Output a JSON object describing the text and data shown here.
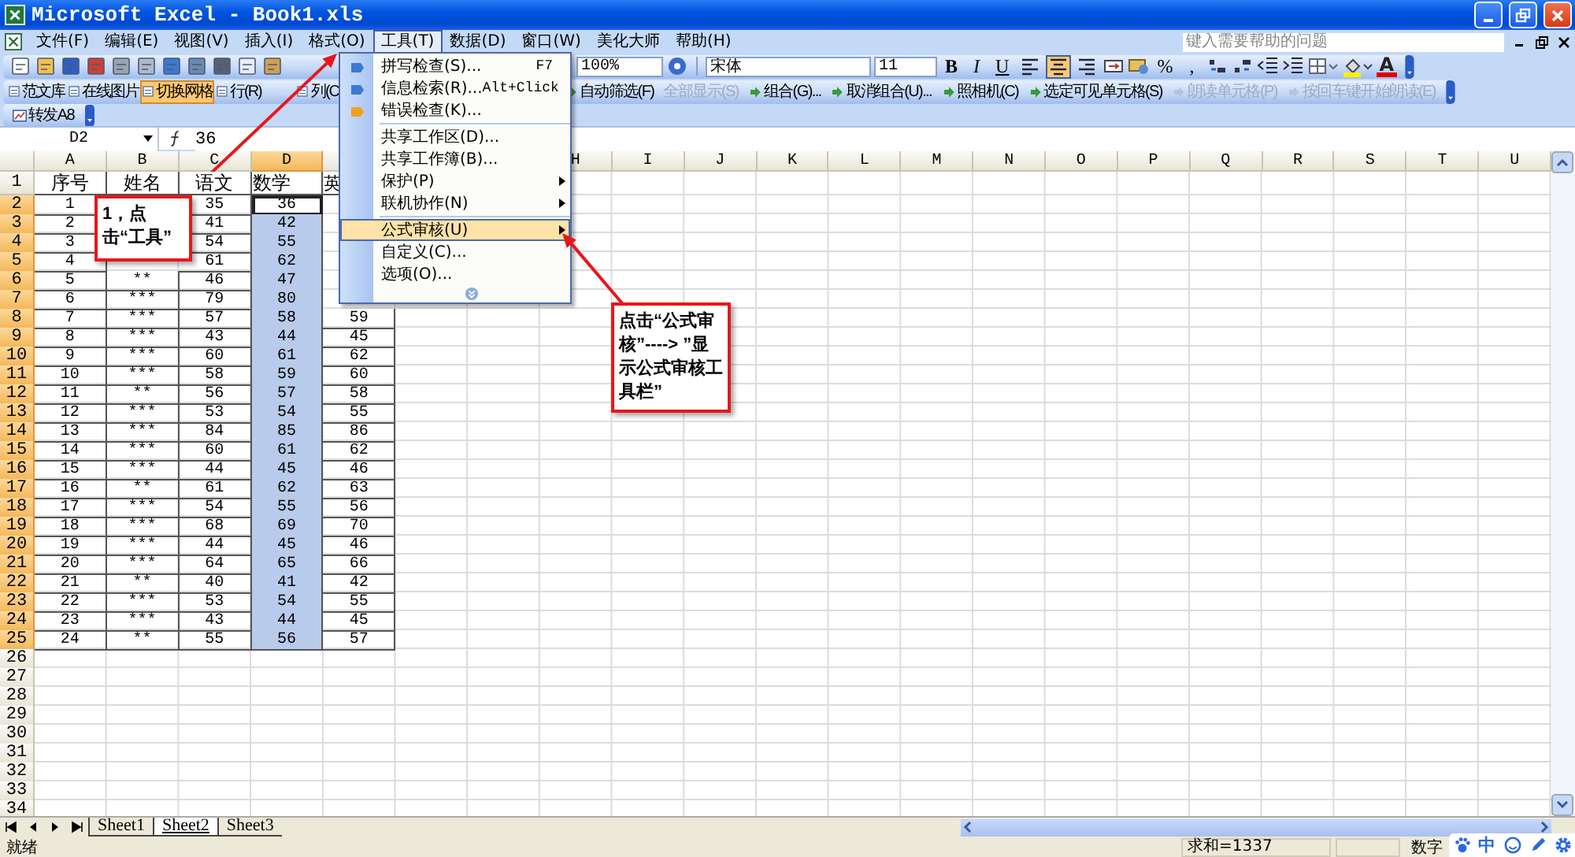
{
  "window": {
    "title": "Microsoft Excel - Book1.xls"
  },
  "menu_bar": {
    "items": [
      {
        "label": "文件(F)",
        "selected": false
      },
      {
        "label": "编辑(E)",
        "selected": false
      },
      {
        "label": "视图(V)",
        "selected": false
      },
      {
        "label": "插入(I)",
        "selected": false
      },
      {
        "label": "格式(O)",
        "selected": false
      },
      {
        "label": "工具(T)",
        "selected": true
      },
      {
        "label": "数据(D)",
        "selected": false
      },
      {
        "label": "窗口(W)",
        "selected": false
      },
      {
        "label": "美化大师",
        "selected": false
      },
      {
        "label": "帮助(H)",
        "selected": false
      }
    ],
    "help_placeholder": "键入需要帮助的问题"
  },
  "formatting_toolbar": {
    "zoom": "100%",
    "font": "宋体",
    "size": "11",
    "style_buttons": [
      "B",
      "I",
      "U"
    ],
    "align_buttons": [
      {
        "selected": false
      },
      {
        "selected": true
      },
      {
        "selected": false
      }
    ],
    "number_buttons": [
      "%",
      ","
    ],
    "font_color_label": "A"
  },
  "toolbar_2": {
    "left": [
      {
        "label": "范文库",
        "selected": false
      },
      {
        "label": "在线图片",
        "selected": false
      },
      {
        "label": "切换网格",
        "selected": true
      },
      {
        "label": "行(R)",
        "selected": false
      },
      {
        "label": "列(C",
        "selected": false
      }
    ],
    "right": [
      {
        "label": "自动筛选(F)",
        "disabled": false
      },
      {
        "label": "全部显示(S)",
        "disabled": true
      },
      {
        "label": "组合(G)...",
        "disabled": false
      },
      {
        "label": "取消组合(U)...",
        "disabled": false
      },
      {
        "label": "照相机(C)",
        "disabled": false
      },
      {
        "label": "选定可见单元格(S)",
        "disabled": false
      },
      {
        "label": "朗读单元格(P)",
        "disabled": true
      },
      {
        "label": "按回车键开始朗读(E)",
        "disabled": true
      }
    ]
  },
  "toolbar_3": {
    "button": "转发A8"
  },
  "formula_bar": {
    "name_box": "D2",
    "formula": "36"
  },
  "tools_menu": {
    "items": [
      {
        "kind": "item",
        "label": "拼写检查(S)...",
        "shortcut": "F7",
        "submenu": false,
        "selected": false
      },
      {
        "kind": "item",
        "label": "信息检索(R)...",
        "shortcut": "Alt+Click",
        "submenu": false,
        "selected": false
      },
      {
        "kind": "item",
        "label": "错误检查(K)...",
        "submenu": false,
        "selected": false
      },
      {
        "kind": "separator"
      },
      {
        "kind": "item",
        "label": "共享工作区(D)...",
        "submenu": false,
        "selected": false
      },
      {
        "kind": "item",
        "label": "共享工作簿(B)...",
        "submenu": false,
        "selected": false
      },
      {
        "kind": "item",
        "label": "保护(P)",
        "submenu": true,
        "selected": false
      },
      {
        "kind": "item",
        "label": "联机协作(N)",
        "submenu": true,
        "selected": false
      },
      {
        "kind": "separator"
      },
      {
        "kind": "item",
        "label": "公式审核(U)",
        "submenu": true,
        "selected": true
      },
      {
        "kind": "item",
        "label": "自定义(C)...",
        "submenu": false,
        "selected": false
      },
      {
        "kind": "item",
        "label": "选项(O)...",
        "submenu": false,
        "selected": false
      },
      {
        "kind": "expand"
      }
    ]
  },
  "sheet": {
    "columns": [
      {
        "label": "A",
        "selected": false
      },
      {
        "label": "B",
        "selected": false
      },
      {
        "label": "C",
        "selected": false
      },
      {
        "label": "D",
        "selected": true
      },
      {
        "selected": false
      },
      {},
      {},
      {
        "label": "H",
        "selected": false
      },
      {
        "label": "I",
        "selected": false
      },
      {
        "label": "J",
        "selected": false
      },
      {
        "label": "K",
        "selected": false
      },
      {
        "label": "L",
        "selected": false
      },
      {
        "label": "M",
        "selected": false
      },
      {
        "label": "N",
        "selected": false
      },
      {
        "label": "O",
        "selected": false
      },
      {
        "label": "P",
        "selected": false
      },
      {
        "label": "Q",
        "selected": false
      },
      {
        "label": "R",
        "selected": false
      },
      {
        "label": "S",
        "selected": false
      },
      {
        "label": "T",
        "selected": false
      },
      {
        "label": "U",
        "selected": false
      }
    ],
    "rows": [
      {
        "header": "1",
        "selected": false,
        "cells": [
          "序号",
          "姓名",
          "语文",
          "数学",
          "英"
        ]
      },
      {
        "header": "2",
        "selected": true,
        "active": true,
        "cells": [
          "1",
          null,
          "35",
          "36",
          null
        ]
      },
      {
        "header": "3",
        "selected": true,
        "active": false,
        "cells": [
          "2",
          null,
          "41",
          "42",
          null
        ]
      },
      {
        "header": "4",
        "selected": true,
        "active": false,
        "cells": [
          "3",
          null,
          "54",
          "55",
          null
        ]
      },
      {
        "header": "5",
        "selected": true,
        "active": false,
        "cells": [
          "4",
          null,
          "61",
          "62",
          null
        ]
      },
      {
        "header": "6",
        "selected": true,
        "active": false,
        "cells": [
          "5",
          "**",
          "46",
          "47",
          null
        ]
      },
      {
        "header": "7",
        "selected": true,
        "active": false,
        "cells": [
          "6",
          "***",
          "79",
          "80",
          null
        ]
      },
      {
        "header": "8",
        "selected": true,
        "active": false,
        "cells": [
          "7",
          "***",
          "57",
          "58",
          "59"
        ]
      },
      {
        "header": "9",
        "selected": true,
        "active": false,
        "cells": [
          "8",
          "***",
          "43",
          "44",
          "45"
        ]
      },
      {
        "header": "10",
        "selected": true,
        "active": false,
        "cells": [
          "9",
          "***",
          "60",
          "61",
          "62"
        ]
      },
      {
        "header": "11",
        "selected": true,
        "active": false,
        "cells": [
          "10",
          "***",
          "58",
          "59",
          "60"
        ]
      },
      {
        "header": "12",
        "selected": true,
        "active": false,
        "cells": [
          "11",
          "**",
          "56",
          "57",
          "58"
        ]
      },
      {
        "header": "13",
        "selected": true,
        "active": false,
        "cells": [
          "12",
          "***",
          "53",
          "54",
          "55"
        ]
      },
      {
        "header": "14",
        "selected": true,
        "active": false,
        "cells": [
          "13",
          "***",
          "84",
          "85",
          "86"
        ]
      },
      {
        "header": "15",
        "selected": true,
        "active": false,
        "cells": [
          "14",
          "***",
          "60",
          "61",
          "62"
        ]
      },
      {
        "header": "16",
        "selected": true,
        "active": false,
        "cells": [
          "15",
          "***",
          "44",
          "45",
          "46"
        ]
      },
      {
        "header": "17",
        "selected": true,
        "active": false,
        "cells": [
          "16",
          "**",
          "61",
          "62",
          "63"
        ]
      },
      {
        "header": "18",
        "selected": true,
        "active": false,
        "cells": [
          "17",
          "***",
          "54",
          "55",
          "56"
        ]
      },
      {
        "header": "19",
        "selected": true,
        "active": false,
        "cells": [
          "18",
          "***",
          "68",
          "69",
          "70"
        ]
      },
      {
        "header": "20",
        "selected": true,
        "active": false,
        "cells": [
          "19",
          "***",
          "44",
          "45",
          "46"
        ]
      },
      {
        "header": "21",
        "selected": true,
        "active": false,
        "cells": [
          "20",
          "***",
          "64",
          "65",
          "66"
        ]
      },
      {
        "header": "22",
        "selected": true,
        "active": false,
        "cells": [
          "21",
          "**",
          "40",
          "41",
          "42"
        ]
      },
      {
        "header": "23",
        "selected": true,
        "active": false,
        "cells": [
          "22",
          "***",
          "53",
          "54",
          "55"
        ]
      },
      {
        "header": "24",
        "selected": true,
        "active": false,
        "cells": [
          "23",
          "***",
          "43",
          "44",
          "45"
        ]
      },
      {
        "header": "25",
        "selected": true,
        "active": false,
        "cells": [
          "24",
          "**",
          "55",
          "56",
          "57"
        ]
      },
      {
        "header": "26",
        "selected": false
      },
      {
        "header": "27",
        "selected": false
      },
      {
        "header": "28",
        "selected": false
      },
      {
        "header": "29",
        "selected": false
      },
      {
        "header": "30",
        "selected": false
      },
      {
        "header": "31",
        "selected": false
      },
      {
        "header": "32",
        "selected": false
      },
      {
        "header": "33",
        "selected": false
      },
      {
        "header": "34",
        "selected": false
      }
    ],
    "tabs": [
      {
        "label": "Sheet1",
        "selected": false
      },
      {
        "label": "Sheet2",
        "selected": true
      },
      {
        "label": "Sheet3",
        "selected": false
      }
    ]
  },
  "callouts": [
    {
      "text": "1，点击“工具”"
    },
    {
      "text": "点击“公式审核”----> ”显示公式审核工具栏”"
    }
  ],
  "status_bar": {
    "state": "就绪",
    "sum": "求和=1337",
    "mode": "数字"
  },
  "ime_bar": {
    "label": "中"
  }
}
